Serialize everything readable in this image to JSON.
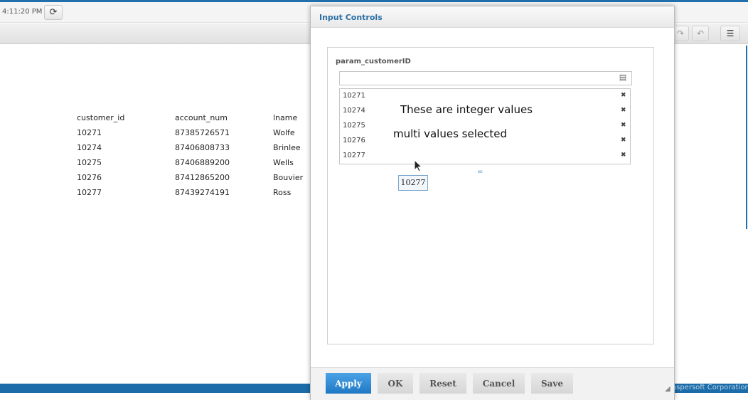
{
  "topbar": {
    "time": "4:11:20 PM",
    "refresh_icon": "refresh-icon"
  },
  "toolbar": {
    "icons": [
      "redo-icon",
      "undo-icon",
      "input-controls-icon"
    ]
  },
  "report": {
    "columns": [
      "customer_id",
      "account_num",
      "lname"
    ],
    "rows": [
      [
        "10271",
        "87385726571",
        "Wolfe"
      ],
      [
        "10274",
        "87406808733",
        "Brinlee"
      ],
      [
        "10275",
        "87406889200",
        "Wells"
      ],
      [
        "10276",
        "87412865200",
        "Bouvier"
      ],
      [
        "10277",
        "87439274191",
        "Ross"
      ]
    ]
  },
  "dialog": {
    "title": "Input Controls",
    "param_label": "param_customerID",
    "search_value": "",
    "selected_values": [
      "10271",
      "10274",
      "10275",
      "10276",
      "10277"
    ],
    "annotation_1": "These are integer values",
    "annotation_2": "multi values selected",
    "tooltip": "10277",
    "buttons": {
      "apply": "Apply",
      "ok": "OK",
      "reset": "Reset",
      "cancel": "Cancel",
      "save": "Save"
    }
  },
  "footer": {
    "text": "aspersoft Corporation"
  },
  "colors": {
    "accent": "#1f78c4",
    "title": "#2a6fa6",
    "footer": "#1b6ca8"
  }
}
